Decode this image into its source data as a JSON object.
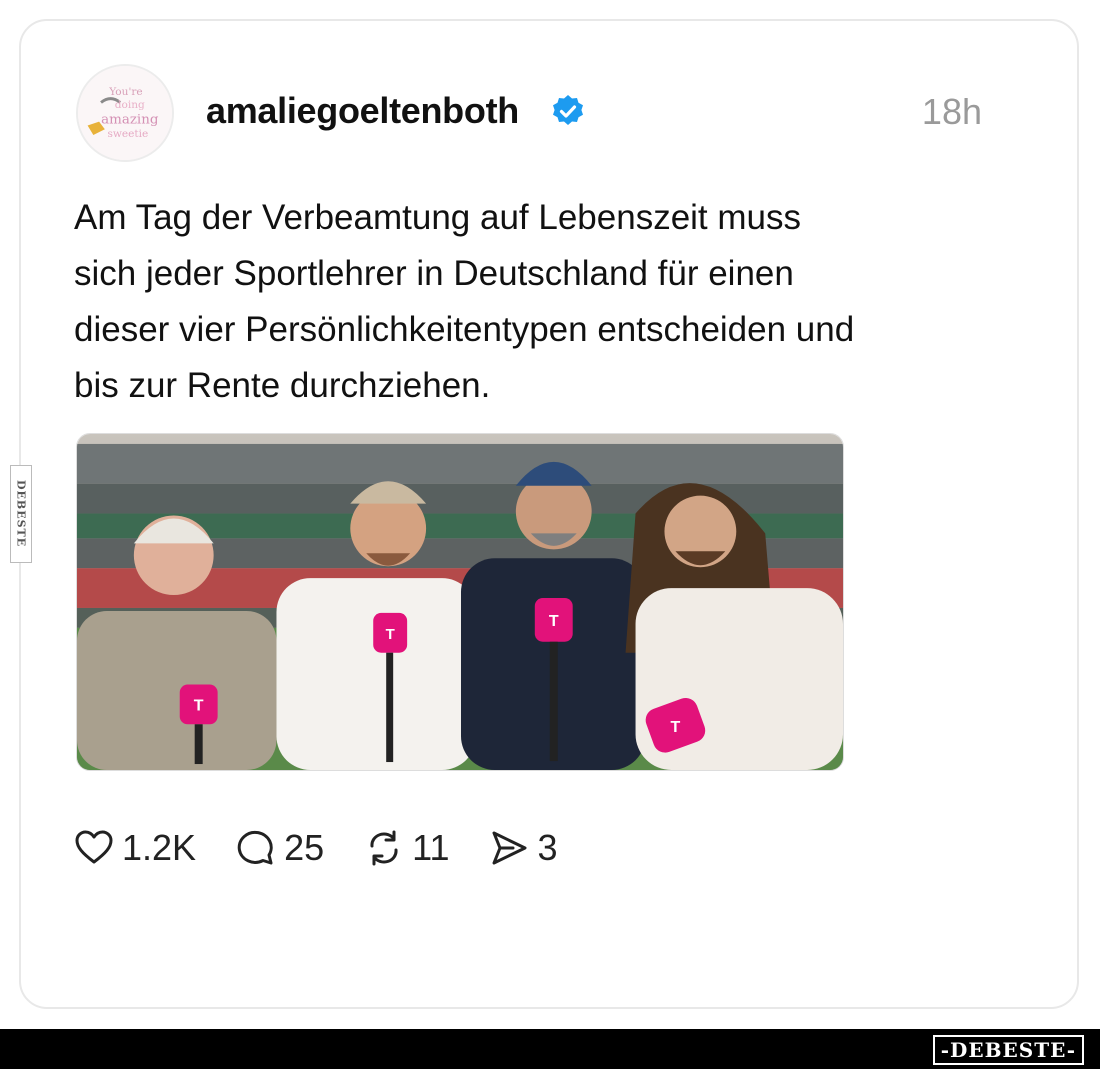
{
  "post": {
    "username": "amaliegoeltenboth",
    "timestamp": "18h",
    "avatar_text": [
      "You're",
      "doing",
      "amazing",
      "sweetie"
    ],
    "text_lines": [
      "Am Tag der Verbeamtung auf Lebenszeit muss",
      "sich jeder Sportlehrer in Deutschland für einen",
      "dieser vier Persönlichkeitentypen entscheiden und",
      "bis zur Rente durchziehen."
    ],
    "verified_icon": "verified-badge-icon",
    "accent_color": "#1d9bf0",
    "mic_color": "#e2127a",
    "mic_logo": "T"
  },
  "actions": {
    "likes": "1.2K",
    "comments": "25",
    "reposts": "11",
    "shares": "3"
  },
  "watermark": {
    "side": "DEBESTE",
    "footer": "-DEBESTE-"
  }
}
